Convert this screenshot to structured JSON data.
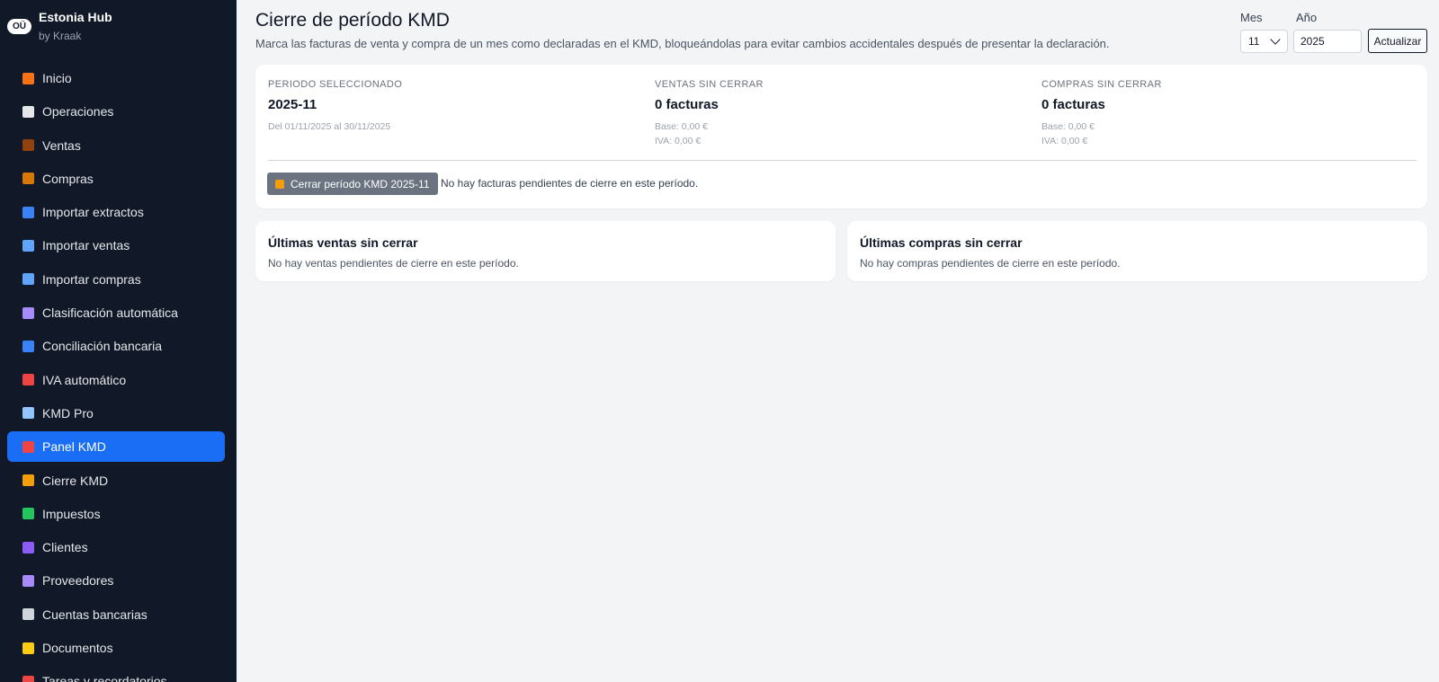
{
  "brand": {
    "badge": "OÜ",
    "name": "Estonia Hub",
    "sub": "by Kraak"
  },
  "nav": [
    {
      "label": "Inicio",
      "icon": "home-icon",
      "color": "#f97316"
    },
    {
      "label": "Operaciones",
      "icon": "document-icon",
      "color": "#e5e7eb"
    },
    {
      "label": "Ventas",
      "icon": "briefcase-icon",
      "color": "#92400e"
    },
    {
      "label": "Compras",
      "icon": "package-icon",
      "color": "#d97706"
    },
    {
      "label": "Importar extractos",
      "icon": "upload-icon",
      "color": "#3b82f6"
    },
    {
      "label": "Importar ventas",
      "icon": "inbox-icon",
      "color": "#60a5fa"
    },
    {
      "label": "Importar compras",
      "icon": "inbox-icon",
      "color": "#60a5fa"
    },
    {
      "label": "Clasificación automática",
      "icon": "robot-icon",
      "color": "#a78bfa"
    },
    {
      "label": "Conciliación bancaria",
      "icon": "refresh-icon",
      "color": "#3b82f6"
    },
    {
      "label": "IVA automático",
      "icon": "abacus-icon",
      "color": "#ef4444"
    },
    {
      "label": "KMD Pro",
      "icon": "bar-chart-icon",
      "color": "#93c5fd"
    },
    {
      "label": "Panel KMD",
      "icon": "pin-icon",
      "color": "#ef4444"
    },
    {
      "label": "Cierre KMD",
      "icon": "lock-icon",
      "color": "#f59e0b"
    },
    {
      "label": "Impuestos",
      "icon": "money-icon",
      "color": "#22c55e"
    },
    {
      "label": "Clientes",
      "icon": "users-icon",
      "color": "#8b5cf6"
    },
    {
      "label": "Proveedores",
      "icon": "factory-icon",
      "color": "#a78bfa"
    },
    {
      "label": "Cuentas bancarias",
      "icon": "bank-icon",
      "color": "#d1d5db"
    },
    {
      "label": "Documentos",
      "icon": "folder-icon",
      "color": "#facc15"
    },
    {
      "label": "Tareas y recordatorios",
      "icon": "alarm-icon",
      "color": "#ef4444"
    }
  ],
  "active_nav": "Panel KMD",
  "header": {
    "title": "Cierre de período KMD",
    "description": "Marca las facturas de venta y compra de un mes como declaradas en el KMD, bloqueándolas para evitar cambios accidentales después de presentar la declaración."
  },
  "filters": {
    "mes_label": "Mes",
    "mes_value": "11",
    "anio_label": "Año",
    "anio_value": "2025",
    "button": "Actualizar"
  },
  "summary": {
    "period_label": "PERIODO SELECCIONADO",
    "period_value": "2025-11",
    "period_range": "Del 01/11/2025 al 30/11/2025",
    "ventas_label": "VENTAS SIN CERRAR",
    "ventas_value": "0 facturas",
    "ventas_base": "Base: 0,00 €",
    "ventas_iva": "IVA: 0,00 €",
    "compras_label": "COMPRAS SIN CERRAR",
    "compras_value": "0 facturas",
    "compras_base": "Base: 0,00 €",
    "compras_iva": "IVA: 0,00 €",
    "close_button": "Cerrar período KMD 2025-11",
    "no_pending": "No hay facturas pendientes de cierre en este período."
  },
  "ventas_panel": {
    "title": "Últimas ventas sin cerrar",
    "text": "No hay ventas pendientes de cierre en este período."
  },
  "compras_panel": {
    "title": "Últimas compras sin cerrar",
    "text": "No hay compras pendientes de cierre en este período."
  }
}
